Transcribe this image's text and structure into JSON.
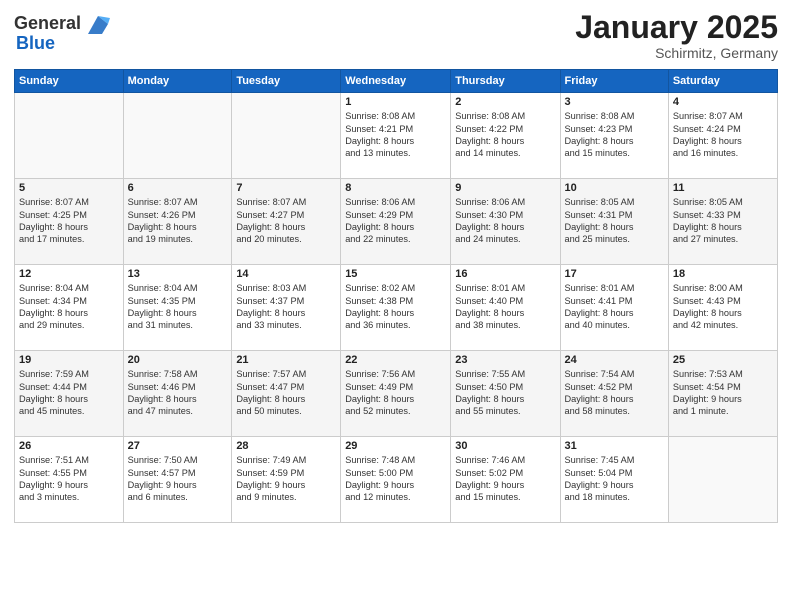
{
  "logo": {
    "general": "General",
    "blue": "Blue"
  },
  "title": "January 2025",
  "subtitle": "Schirmitz, Germany",
  "days_header": [
    "Sunday",
    "Monday",
    "Tuesday",
    "Wednesday",
    "Thursday",
    "Friday",
    "Saturday"
  ],
  "weeks": [
    [
      {
        "day": "",
        "info": ""
      },
      {
        "day": "",
        "info": ""
      },
      {
        "day": "",
        "info": ""
      },
      {
        "day": "1",
        "info": "Sunrise: 8:08 AM\nSunset: 4:21 PM\nDaylight: 8 hours\nand 13 minutes."
      },
      {
        "day": "2",
        "info": "Sunrise: 8:08 AM\nSunset: 4:22 PM\nDaylight: 8 hours\nand 14 minutes."
      },
      {
        "day": "3",
        "info": "Sunrise: 8:08 AM\nSunset: 4:23 PM\nDaylight: 8 hours\nand 15 minutes."
      },
      {
        "day": "4",
        "info": "Sunrise: 8:07 AM\nSunset: 4:24 PM\nDaylight: 8 hours\nand 16 minutes."
      }
    ],
    [
      {
        "day": "5",
        "info": "Sunrise: 8:07 AM\nSunset: 4:25 PM\nDaylight: 8 hours\nand 17 minutes."
      },
      {
        "day": "6",
        "info": "Sunrise: 8:07 AM\nSunset: 4:26 PM\nDaylight: 8 hours\nand 19 minutes."
      },
      {
        "day": "7",
        "info": "Sunrise: 8:07 AM\nSunset: 4:27 PM\nDaylight: 8 hours\nand 20 minutes."
      },
      {
        "day": "8",
        "info": "Sunrise: 8:06 AM\nSunset: 4:29 PM\nDaylight: 8 hours\nand 22 minutes."
      },
      {
        "day": "9",
        "info": "Sunrise: 8:06 AM\nSunset: 4:30 PM\nDaylight: 8 hours\nand 24 minutes."
      },
      {
        "day": "10",
        "info": "Sunrise: 8:05 AM\nSunset: 4:31 PM\nDaylight: 8 hours\nand 25 minutes."
      },
      {
        "day": "11",
        "info": "Sunrise: 8:05 AM\nSunset: 4:33 PM\nDaylight: 8 hours\nand 27 minutes."
      }
    ],
    [
      {
        "day": "12",
        "info": "Sunrise: 8:04 AM\nSunset: 4:34 PM\nDaylight: 8 hours\nand 29 minutes."
      },
      {
        "day": "13",
        "info": "Sunrise: 8:04 AM\nSunset: 4:35 PM\nDaylight: 8 hours\nand 31 minutes."
      },
      {
        "day": "14",
        "info": "Sunrise: 8:03 AM\nSunset: 4:37 PM\nDaylight: 8 hours\nand 33 minutes."
      },
      {
        "day": "15",
        "info": "Sunrise: 8:02 AM\nSunset: 4:38 PM\nDaylight: 8 hours\nand 36 minutes."
      },
      {
        "day": "16",
        "info": "Sunrise: 8:01 AM\nSunset: 4:40 PM\nDaylight: 8 hours\nand 38 minutes."
      },
      {
        "day": "17",
        "info": "Sunrise: 8:01 AM\nSunset: 4:41 PM\nDaylight: 8 hours\nand 40 minutes."
      },
      {
        "day": "18",
        "info": "Sunrise: 8:00 AM\nSunset: 4:43 PM\nDaylight: 8 hours\nand 42 minutes."
      }
    ],
    [
      {
        "day": "19",
        "info": "Sunrise: 7:59 AM\nSunset: 4:44 PM\nDaylight: 8 hours\nand 45 minutes."
      },
      {
        "day": "20",
        "info": "Sunrise: 7:58 AM\nSunset: 4:46 PM\nDaylight: 8 hours\nand 47 minutes."
      },
      {
        "day": "21",
        "info": "Sunrise: 7:57 AM\nSunset: 4:47 PM\nDaylight: 8 hours\nand 50 minutes."
      },
      {
        "day": "22",
        "info": "Sunrise: 7:56 AM\nSunset: 4:49 PM\nDaylight: 8 hours\nand 52 minutes."
      },
      {
        "day": "23",
        "info": "Sunrise: 7:55 AM\nSunset: 4:50 PM\nDaylight: 8 hours\nand 55 minutes."
      },
      {
        "day": "24",
        "info": "Sunrise: 7:54 AM\nSunset: 4:52 PM\nDaylight: 8 hours\nand 58 minutes."
      },
      {
        "day": "25",
        "info": "Sunrise: 7:53 AM\nSunset: 4:54 PM\nDaylight: 9 hours\nand 1 minute."
      }
    ],
    [
      {
        "day": "26",
        "info": "Sunrise: 7:51 AM\nSunset: 4:55 PM\nDaylight: 9 hours\nand 3 minutes."
      },
      {
        "day": "27",
        "info": "Sunrise: 7:50 AM\nSunset: 4:57 PM\nDaylight: 9 hours\nand 6 minutes."
      },
      {
        "day": "28",
        "info": "Sunrise: 7:49 AM\nSunset: 4:59 PM\nDaylight: 9 hours\nand 9 minutes."
      },
      {
        "day": "29",
        "info": "Sunrise: 7:48 AM\nSunset: 5:00 PM\nDaylight: 9 hours\nand 12 minutes."
      },
      {
        "day": "30",
        "info": "Sunrise: 7:46 AM\nSunset: 5:02 PM\nDaylight: 9 hours\nand 15 minutes."
      },
      {
        "day": "31",
        "info": "Sunrise: 7:45 AM\nSunset: 5:04 PM\nDaylight: 9 hours\nand 18 minutes."
      },
      {
        "day": "",
        "info": ""
      }
    ]
  ]
}
